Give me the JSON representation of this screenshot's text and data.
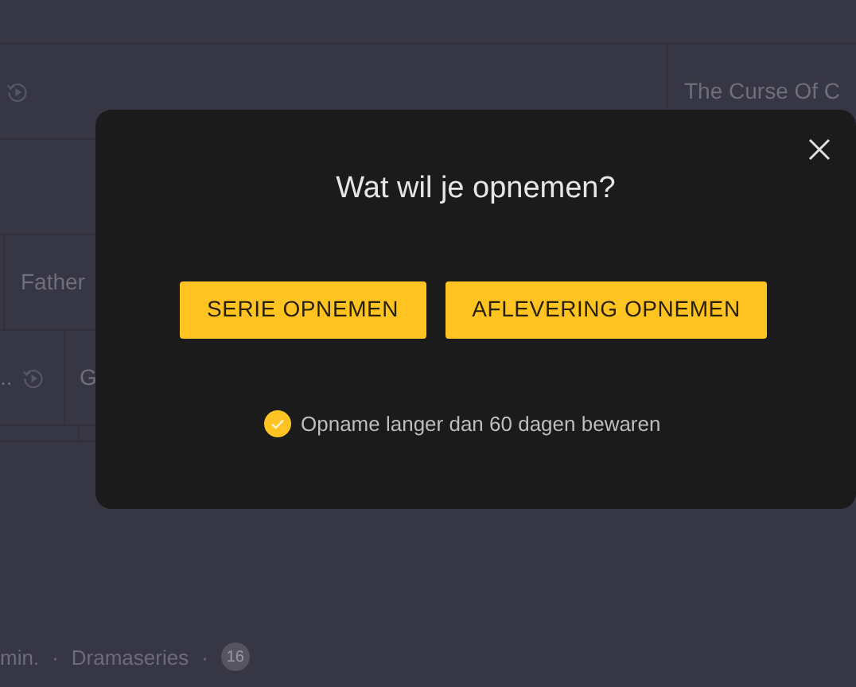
{
  "guide": {
    "rows": [
      {
        "cells": [
          {}
        ]
      },
      {
        "cells": [
          {
            "replay": true
          },
          {
            "title": "The Curse Of C"
          }
        ]
      },
      {
        "cells": [
          {}
        ]
      },
      {
        "cells": [
          {},
          {
            "title": "Father"
          }
        ]
      },
      {
        "cells": [
          {
            "title": "..",
            "replay": true
          },
          {
            "title": "G"
          }
        ]
      },
      {
        "cells": [
          {},
          {}
        ]
      }
    ]
  },
  "details": {
    "meta": [
      "min.",
      "Dramaseries"
    ],
    "separator": "·",
    "age_rating": "16"
  },
  "dialog": {
    "title": "Wat wil je opnemen?",
    "buttons": [
      "SERIE OPNEMEN",
      "AFLEVERING OPNEMEN"
    ],
    "option": {
      "label": "Opname langer dan 60 dagen bewaren",
      "checked": true
    }
  }
}
